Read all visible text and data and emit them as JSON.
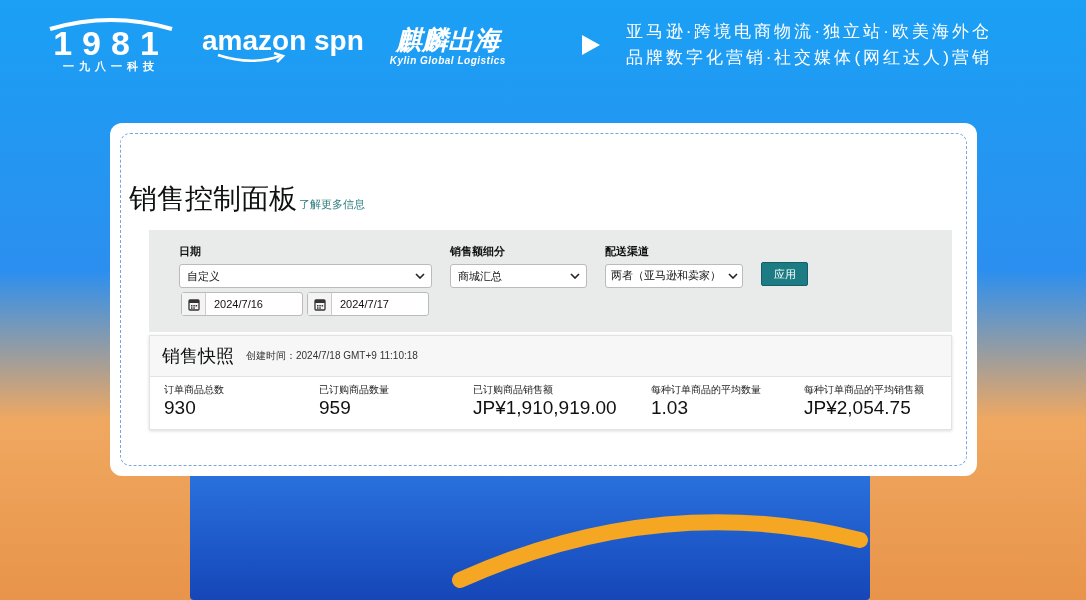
{
  "header": {
    "logos": [
      {
        "kind": "mark",
        "text": "1981",
        "caption": "一九八一科技"
      },
      {
        "kind": "wordmark",
        "text": "amazon spn"
      },
      {
        "kind": "bilingual",
        "text": "麒麟出海",
        "caption": "Kylin Global Logistics"
      }
    ],
    "tagline": [
      "亚马逊·跨境电商物流·独立站·欧美海外仓",
      "品牌数字化营销·社交媒体(网红达人)营销"
    ]
  },
  "dashboard": {
    "title": "销售控制面板",
    "learn_more": "了解更多信息",
    "filters": [
      {
        "label": "日期",
        "value": "自定义",
        "dates": [
          "2024/7/16",
          "2024/7/17"
        ]
      },
      {
        "label": "销售额细分",
        "value": "商城汇总"
      },
      {
        "label": "配送渠道",
        "value": "两者（亚马逊和卖家）"
      }
    ],
    "apply_button": "应用",
    "snapshot": {
      "title": "销售快照",
      "created": "创建时间：2024/7/18 GMT+9 11:10:18",
      "metrics": [
        {
          "label": "订单商品总数",
          "value": "930"
        },
        {
          "label": "已订购商品数量",
          "value": "959"
        },
        {
          "label": "已订购商品销售额",
          "value": "JP¥1,910,919.00"
        },
        {
          "label": "每种订单商品的平均数量",
          "value": "1.03"
        },
        {
          "label": "每种订单商品的平均销售额",
          "value": "JP¥2,054.75"
        }
      ]
    }
  }
}
